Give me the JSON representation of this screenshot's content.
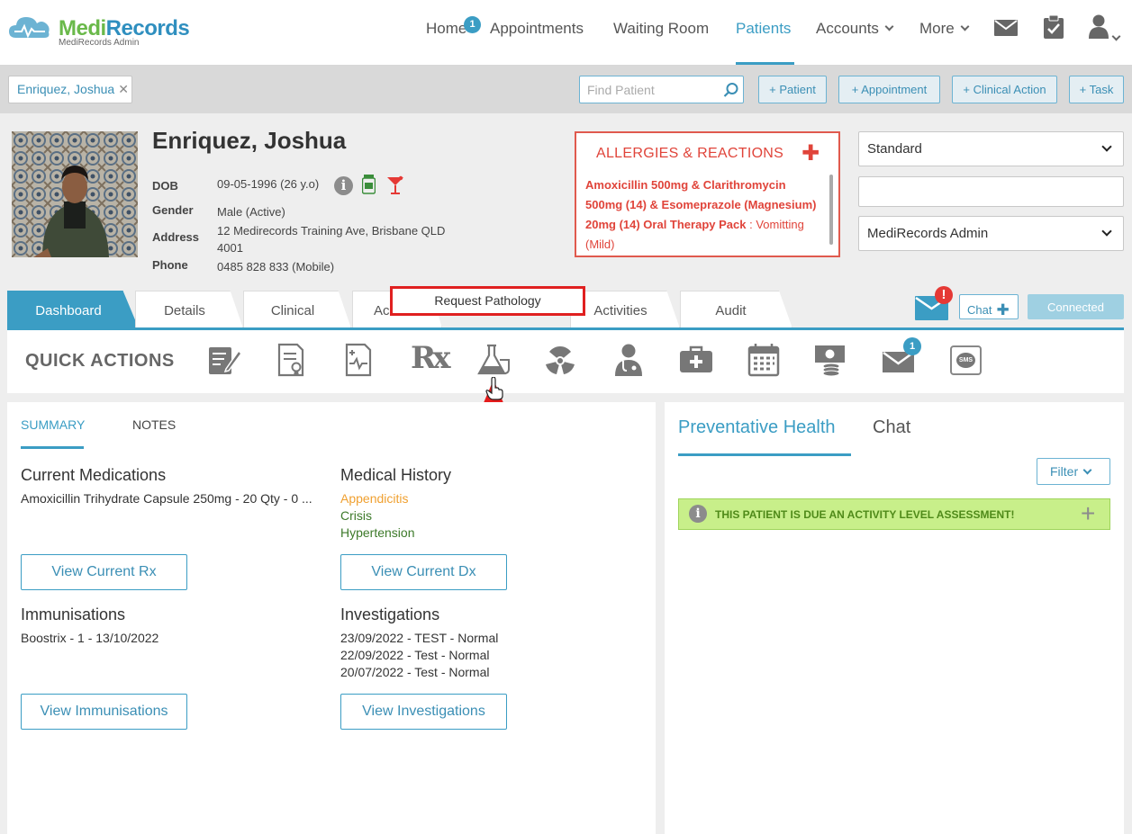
{
  "brand": {
    "name_part1": "Medi",
    "name_part2": "Records",
    "subtitle": "MediRecords Admin"
  },
  "nav": {
    "home": "Home",
    "home_badge": "1",
    "appointments": "Appointments",
    "waiting_room": "Waiting Room",
    "patients": "Patients",
    "accounts": "Accounts",
    "more": "More"
  },
  "toolbar": {
    "open_patient": "Enriquez, Joshua",
    "find_placeholder": "Find Patient",
    "add_patient": "+ Patient",
    "add_appointment": "+ Appointment",
    "add_clinical_action": "+ Clinical Action",
    "add_task": "+ Task"
  },
  "patient": {
    "name": "Enriquez, Joshua",
    "dob_label": "DOB",
    "dob": "09-05-1996 (26 y.o)",
    "gender_label": "Gender",
    "gender": "Male (Active)",
    "address_label": "Address",
    "address_line1": "12 Medirecords Training Ave, Brisbane QLD",
    "address_line2": "4001",
    "phone_label": "Phone",
    "phone": "0485 828 833 (Mobile)"
  },
  "allergies": {
    "title": "ALLERGIES & REACTIONS",
    "drug": "Amoxicillin 500mg & Clarithromycin 500mg (14) & Esomeprazole (Magnesium) 20mg (14) Oral Therapy Pack",
    "reaction": " : Vomitting (Mild)"
  },
  "selects": {
    "billing": "Standard",
    "blank": "",
    "practitioner": "MediRecords Admin"
  },
  "tabs": [
    "Dashboard",
    "Details",
    "Clinical",
    "Ac",
    "Activities",
    "Audit"
  ],
  "tab_actions": {
    "chat": "Chat",
    "connected": "Connected",
    "alert": "!"
  },
  "tooltip": "Request Pathology",
  "quick_actions": {
    "title": "QUICK ACTIONS",
    "mail_badge": "1",
    "sms_text": "SMS",
    "rx_text": "Rx"
  },
  "summary": {
    "tab_summary": "SUMMARY",
    "tab_notes": "NOTES",
    "medications_title": "Current Medications",
    "medication": "Amoxicillin Trihydrate Capsule 250mg - 20 Qty - 0 ...",
    "history_title": "Medical History",
    "history": [
      {
        "text": "Appendicitis",
        "color": "#f0a030"
      },
      {
        "text": "Crisis",
        "color": "#3d7a2a"
      },
      {
        "text": "Hypertension",
        "color": "#3d7a2a"
      }
    ],
    "view_rx": "View Current Rx",
    "view_dx": "View Current Dx",
    "immunisations_title": "Immunisations",
    "immunisation": "Boostrix - 1 - 13/10/2022",
    "investigations_title": "Investigations",
    "investigations": [
      "23/09/2022 - TEST - Normal",
      "22/09/2022 - Test - Normal",
      "20/07/2022 - Test - Normal"
    ],
    "view_immunisations": "View Immunisations",
    "view_investigations": "View Investigations"
  },
  "right_panel": {
    "tab_preventative": "Preventative Health",
    "tab_chat": "Chat",
    "filter": "Filter",
    "alert": "THIS PATIENT IS DUE AN ACTIVITY LEVEL ASSESSMENT!",
    "alert_info": "i",
    "alert_plus": "+"
  }
}
